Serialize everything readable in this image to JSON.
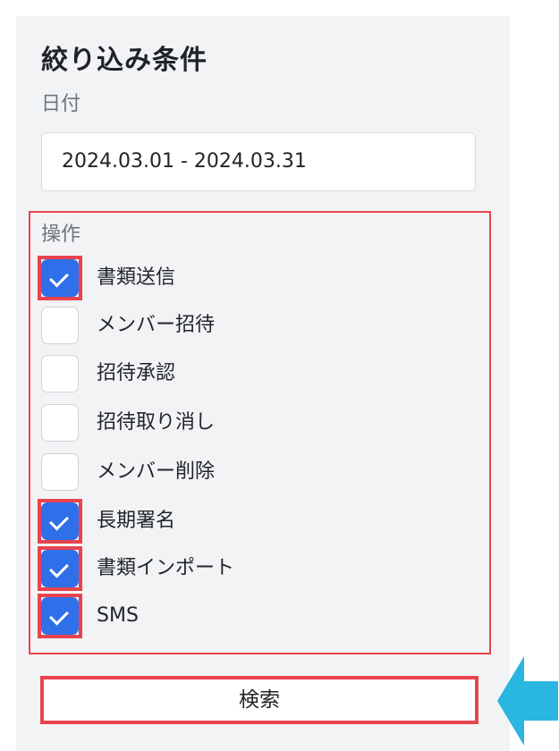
{
  "filter": {
    "title": "絞り込み条件",
    "date_label": "日付",
    "date_value": "2024.03.01 - 2024.03.31",
    "operations_label": "操作",
    "operations": [
      {
        "label": "書類送信",
        "checked": true,
        "highlighted": true
      },
      {
        "label": "メンバー招待",
        "checked": false,
        "highlighted": false
      },
      {
        "label": "招待承認",
        "checked": false,
        "highlighted": false
      },
      {
        "label": "招待取り消し",
        "checked": false,
        "highlighted": false
      },
      {
        "label": "メンバー削除",
        "checked": false,
        "highlighted": false
      },
      {
        "label": "長期署名",
        "checked": true,
        "highlighted": true
      },
      {
        "label": "書類インポート",
        "checked": true,
        "highlighted": true
      },
      {
        "label": "SMS",
        "checked": true,
        "highlighted": true
      }
    ],
    "search_button": "検索"
  },
  "colors": {
    "accent": "#2f6fea",
    "highlight": "#e8434e",
    "arrow": "#29b6e0",
    "panel": "#f2f3f5"
  }
}
